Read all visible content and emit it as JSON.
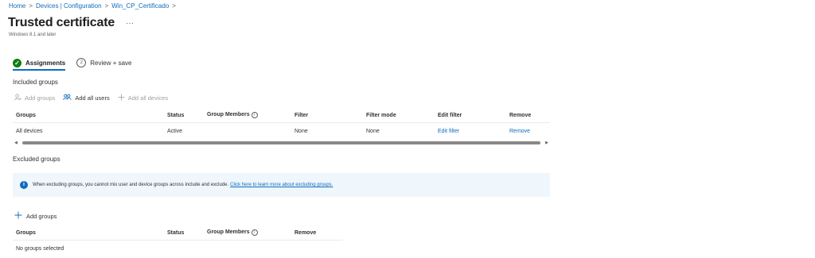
{
  "breadcrumb": {
    "items": [
      "Home",
      "Devices | Configuration",
      "Win_CP_Certificado"
    ],
    "separator": ">"
  },
  "page": {
    "title": "Trusted certificate",
    "more": "···",
    "subtitle": "Windows 8.1 and later"
  },
  "steps": {
    "assignments": "Assignments",
    "review_number": "2",
    "review": "Review + save"
  },
  "included": {
    "heading": "Included groups",
    "toolbar": {
      "add_groups": "Add groups",
      "add_all_users": "Add all users",
      "add_all_devices": "Add all devices"
    },
    "columns": [
      "Groups",
      "Status",
      "Group Members",
      "Filter",
      "Filter mode",
      "Edit filter",
      "Remove"
    ],
    "rows": [
      {
        "group": "All devices",
        "status": "Active",
        "members": "",
        "filter": "None",
        "filter_mode": "None",
        "edit_filter": "Edit filter",
        "remove": "Remove"
      }
    ]
  },
  "excluded": {
    "heading": "Excluded groups",
    "info_text": "When excluding groups, you cannot mix user and device groups across include and exclude.",
    "info_link": "Click here to learn more about excluding groups.",
    "add_groups": "Add groups",
    "columns": [
      "Groups",
      "Status",
      "Group Members",
      "Remove"
    ],
    "empty_text": "No groups selected"
  },
  "icons": {
    "check": "check-icon",
    "info": "info-icon",
    "person": "person-icon",
    "people": "people-icon",
    "plus": "plus-icon"
  },
  "colors": {
    "accent": "#0f6cbd",
    "success": "#107c10",
    "info_bg": "#eff6fc"
  }
}
